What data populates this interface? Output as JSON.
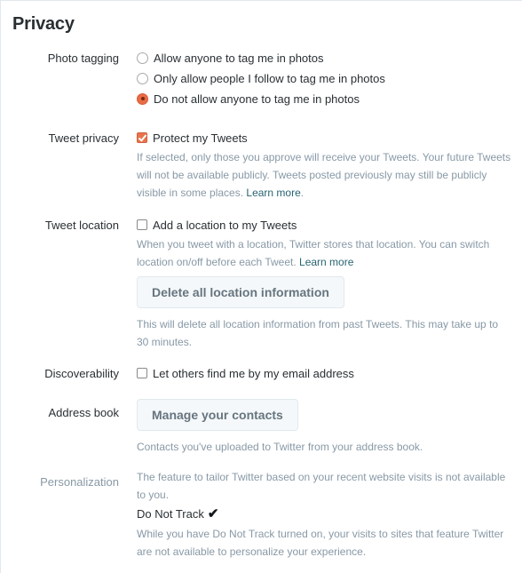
{
  "page": {
    "title": "Privacy"
  },
  "photo_tagging": {
    "label": "Photo tagging",
    "options": [
      {
        "label": "Allow anyone to tag me in photos",
        "selected": false
      },
      {
        "label": "Only allow people I follow to tag me in photos",
        "selected": false
      },
      {
        "label": "Do not allow anyone to tag me in photos",
        "selected": true
      }
    ]
  },
  "tweet_privacy": {
    "label": "Tweet privacy",
    "checkbox_label": "Protect my Tweets",
    "checked": true,
    "help": "If selected, only those you approve will receive your Tweets. Your future Tweets will not be available publicly. Tweets posted previously may still be publicly visible in some places.",
    "learn_more": "Learn more"
  },
  "tweet_location": {
    "label": "Tweet location",
    "checkbox_label": "Add a location to my Tweets",
    "checked": false,
    "help": "When you tweet with a location, Twitter stores that location. You can switch location on/off before each Tweet.",
    "learn_more": "Learn more",
    "delete_button": "Delete all location information",
    "delete_help": "This will delete all location information from past Tweets. This may take up to 30 minutes."
  },
  "discoverability": {
    "label": "Discoverability",
    "checkbox_label": "Let others find me by my email address",
    "checked": false
  },
  "address_book": {
    "label": "Address book",
    "button": "Manage your contacts",
    "help": "Contacts you've uploaded to Twitter from your address book."
  },
  "personalization": {
    "label": "Personalization",
    "help": "The feature to tailor Twitter based on your recent website visits is not available to you.",
    "dnt_label": "Do Not Track",
    "dnt_icon": "checkmark-icon",
    "dnt_help": "While you have Do Not Track turned on, your visits to sites that feature Twitter are not available to personalize your experience."
  },
  "colors": {
    "accent": "#e8744c",
    "text": "#292f33",
    "muted": "#8899a6",
    "link": "#276472",
    "button_bg": "#f5f8fa",
    "button_text": "#66757f"
  }
}
